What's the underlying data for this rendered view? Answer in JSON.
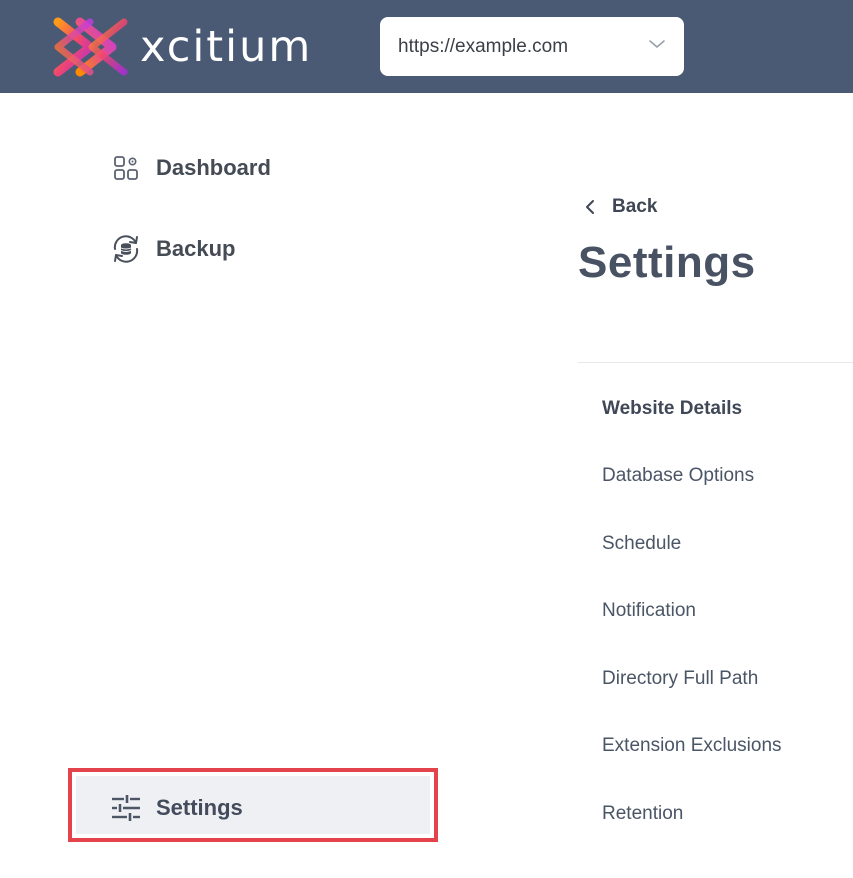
{
  "header": {
    "logo_text": "xcitium",
    "site_select": {
      "value": "https://example.com",
      "icon": "chevron-down-icon"
    }
  },
  "sidebar": {
    "items": [
      {
        "label": "Dashboard",
        "icon": "dashboard-icon"
      },
      {
        "label": "Backup",
        "icon": "backup-icon"
      },
      {
        "label": "Settings",
        "icon": "sliders-icon",
        "active": true
      }
    ]
  },
  "settings_panel": {
    "back_label": "Back",
    "title": "Settings",
    "items": [
      {
        "label": "Website Details",
        "active": true
      },
      {
        "label": "Database Options"
      },
      {
        "label": "Schedule"
      },
      {
        "label": "Notification"
      },
      {
        "label": "Directory Full Path"
      },
      {
        "label": "Extension Exclusions"
      },
      {
        "label": "Retention"
      }
    ]
  },
  "colors": {
    "header_bg": "#4b5a74",
    "highlight_border": "#e5434c",
    "active_item_bg": "#eef0f3",
    "logo_gradient_start": "#ff8a00",
    "logo_gradient_end": "#b02bd8"
  }
}
